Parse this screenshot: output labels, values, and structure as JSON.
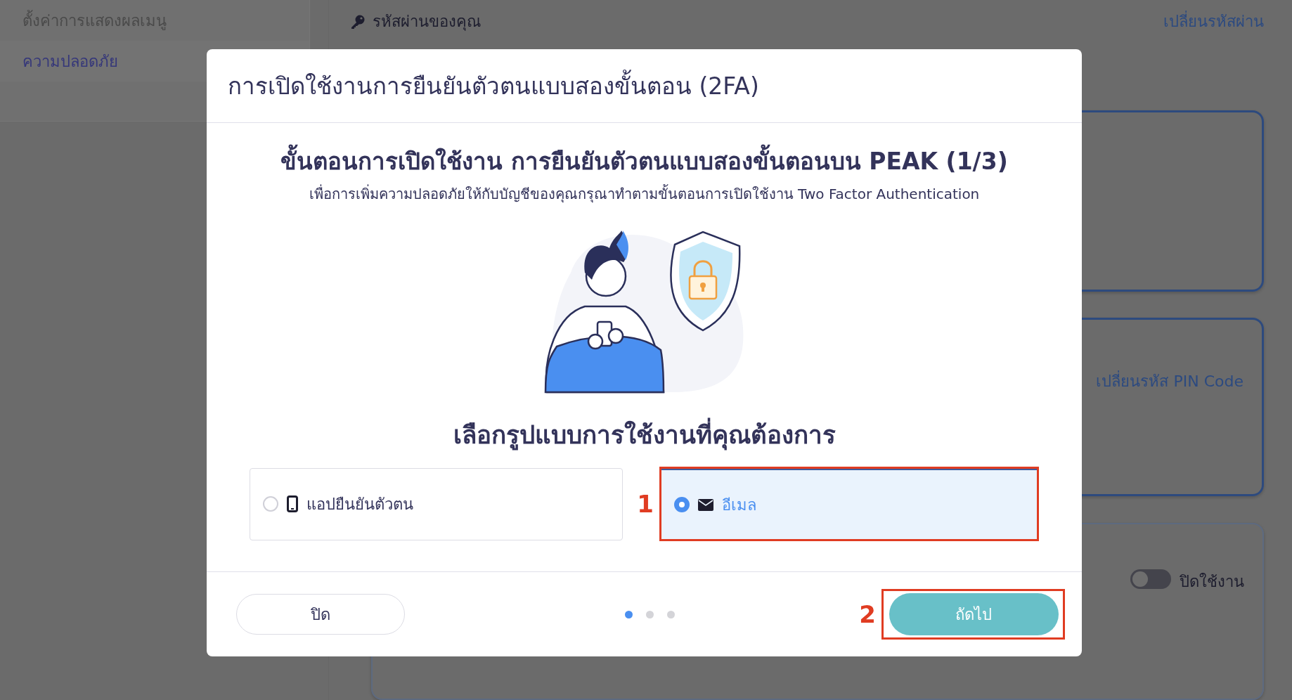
{
  "sidebar": {
    "items": [
      {
        "label": "ตั้งค่าการแสดงผลเมนู",
        "selected": false
      },
      {
        "label": "ความปลอดภัย",
        "selected": true
      }
    ]
  },
  "password_section": {
    "title": "รหัสผ่านของคุณ",
    "link": "เปลี่ยนรหัสผ่าน"
  },
  "pin_card": {
    "link": "เปลี่ยนรหัส PIN Code"
  },
  "toggle_card": {
    "toggle": {
      "label": "ปิดใช้งาน",
      "on": false
    }
  },
  "modal": {
    "title": "การเปิดใช้งานการยืนยันตัวตนแบบสองขั้นตอน (2FA)",
    "heading": "ขั้นตอนการเปิดใช้งาน การยืนยันตัวตนแบบสองขั้นตอนบน PEAK (1/3)",
    "subtitle": "เพื่อการเพิ่มความปลอดภัยให้กับบัญชีของคุณกรุณาทำตามขั้นตอนการเปิดใช้งาน Two Factor Authentication",
    "choose_label": "เลือกรูปแบบการใช้งานที่คุณต้องการ",
    "options": [
      {
        "label": "แอปยืนยันตัวตน",
        "kind": "app",
        "selected": false
      },
      {
        "label": "อีเมล",
        "kind": "email",
        "selected": true,
        "annotation": "1"
      }
    ],
    "steps": [
      {
        "selected": true
      },
      {
        "selected": false
      },
      {
        "selected": false
      }
    ],
    "close_button": "ปิด",
    "next_button": {
      "label": "ถัดไป",
      "annotation": "2"
    }
  }
}
